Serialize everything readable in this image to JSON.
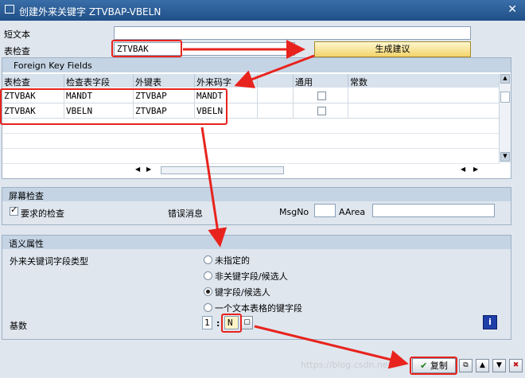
{
  "window": {
    "title": "创建外来关键字 ZTVBAP-VBELN",
    "close": "✕"
  },
  "form": {
    "short_text_label": "短文本",
    "short_text_value": "",
    "check_table_label": "表检查",
    "check_table_value": "ZTVBAK",
    "generate_btn": "生成建议"
  },
  "grid": {
    "title": "Foreign Key Fields",
    "headers": [
      "表检查",
      "检查表字段",
      "外键表",
      "外来码字",
      "",
      "通用",
      "常数"
    ],
    "rows": [
      [
        "ZTVBAK",
        "MANDT",
        "ZTVBAP",
        "MANDT",
        ""
      ],
      [
        "ZTVBAK",
        "VBELN",
        "ZTVBAP",
        "VBELN",
        ""
      ]
    ]
  },
  "screen_check": {
    "title": "屏幕检查",
    "required_check": "要求的检查",
    "error_msg_label": "错误消息",
    "msgno_label": "MsgNo",
    "msgno_value": "",
    "aarea_label": "AArea",
    "aarea_value": ""
  },
  "semantic": {
    "title": "语义属性",
    "fk_type_label": "外来关键词字段类型",
    "options": [
      "未指定的",
      "非关键字段/候选人",
      "键字段/候选人",
      "一个文本表格的键字段"
    ],
    "selected_index": 2,
    "cardinality_label": "基数",
    "card_left": "1",
    "card_sep": ":",
    "card_right": "N"
  },
  "footer": {
    "copy_btn": "复制"
  },
  "watermark": "https://blog.csdn.net/..."
}
